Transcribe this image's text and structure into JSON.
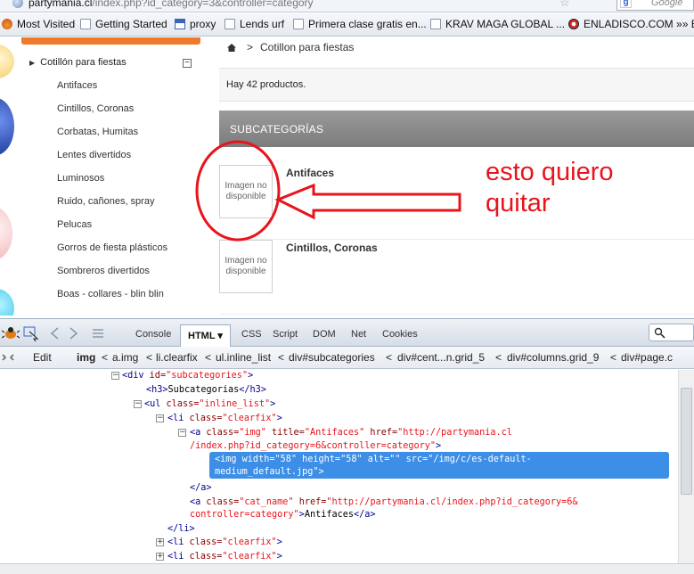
{
  "browser": {
    "url_prefix": "partymania.cl",
    "url_rest": "/index.php?id_category=3&controller=category",
    "search_placeholder": "Google"
  },
  "bookmarks": [
    {
      "label": "Most Visited",
      "icon": "fx-icon"
    },
    {
      "label": "Getting Started",
      "icon": "page-icon"
    },
    {
      "label": "proxy",
      "icon": "calendar-icon"
    },
    {
      "label": "Lends urf",
      "icon": "page-icon"
    },
    {
      "label": "Primera clase gratis en...",
      "icon": "page-icon"
    },
    {
      "label": "KRAV MAGA GLOBAL ...",
      "icon": "page-icon"
    },
    {
      "label": "ENLADISCO.COM »» E...",
      "icon": "record-icon"
    }
  ],
  "sidebar": {
    "category": "Cotillón para fiestas",
    "items": [
      "Antifaces",
      "Cintillos, Coronas",
      "Corbatas, Humitas",
      "Lentes divertidos",
      "Luminosos",
      "Ruido, cañones, spray",
      "Pelucas",
      "Gorros de fiesta plásticos",
      "Sombreros divertidos",
      "Boas - collares - blin blin"
    ]
  },
  "main": {
    "breadcrumb_sep": ">",
    "breadcrumb": "Cotillon para fiestas",
    "product_count": "Hay 42 productos.",
    "subcategories_title": "SUBCATEGORÍAS",
    "subcategories": [
      {
        "name": "Antifaces",
        "image_text_1": "Imagen no",
        "image_text_2": "disponible"
      },
      {
        "name": "Cintillos, Coronas",
        "image_text_1": "Imagen no",
        "image_text_2": "disponible"
      }
    ],
    "annotation_line1": "esto quiero",
    "annotation_line2": "quitar"
  },
  "firebug": {
    "tabs": [
      "Console",
      "HTML",
      "CSS",
      "Script",
      "DOM",
      "Net",
      "Cookies"
    ],
    "active_tab": "HTML",
    "edit_label": "Edit",
    "crumbs": [
      "img",
      "a.img",
      "li.clearfix",
      "ul.inline_list",
      "div#subcategories",
      "div#cent...n.grid_5",
      "div#columns.grid_9",
      "div#page.c"
    ],
    "tree": {
      "l1_tag": "<div ",
      "l1_attr": "id=",
      "l1_val": "\"subcategories\"",
      "l1_end": ">",
      "l2": "<h3>",
      "l2_text": "Subcategorias",
      "l2_end": "</h3>",
      "l3_tag": "<ul ",
      "l3_attr": "class=",
      "l3_val": "\"inline_list\"",
      "l3_end": ">",
      "l4_tag": "<li ",
      "l4_attr": "class=",
      "l4_val": "\"clearfix\"",
      "l4_end": ">",
      "l5_tag": "<a ",
      "l5_a1": "class=",
      "l5_v1": "\"img\"",
      "l5_a2": " title=",
      "l5_v2": "\"Antifaces\"",
      "l5_a3": " href=",
      "l5_v3": "\"http://partymania.cl",
      "l6_v": "/index.php?id_category=6&controller=category\"",
      "l6_end": ">",
      "l7": "<img width=\"58\" height=\"58\" alt=\"\" src=\"/img/c/es-default-",
      "l8": "medium_default.jpg\">",
      "l9": "</a>",
      "l10_tag": "<a ",
      "l10_attr": "class=",
      "l10_val": "\"cat_name\"",
      "l10_a2": " href=",
      "l10_v2": "\"http://partymania.cl/index.php?id_category=6&",
      "l11_v": "controller=category\"",
      "l11_end": ">",
      "l11_text": "Antifaces",
      "l11_close": "</a>",
      "l12": "</li>",
      "l13_tag": "<li ",
      "l13_attr": "class=",
      "l13_val": "\"clearfix\"",
      "l13_end": ">",
      "l14_tag": "<li ",
      "l14_attr": "class=",
      "l14_val": "\"clearfix\"",
      "l14_end": ">"
    }
  }
}
